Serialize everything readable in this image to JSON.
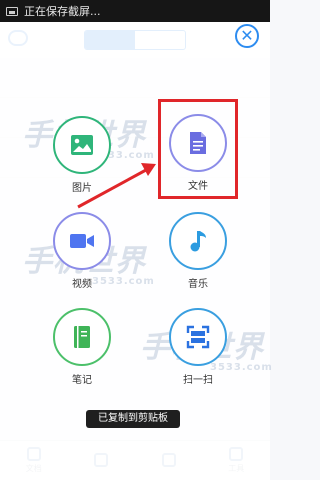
{
  "status_bar": {
    "text": "正在保存截屏..."
  },
  "background": {
    "tabs": [
      "",
      ""
    ],
    "bottom_nav": [
      "文档",
      "",
      "",
      "工具"
    ]
  },
  "menu": {
    "items": [
      {
        "id": "image",
        "label": "图片",
        "icon": "image-icon",
        "color": "#2fb57a"
      },
      {
        "id": "file",
        "label": "文件",
        "icon": "file-icon",
        "color": "#6a6de0"
      },
      {
        "id": "video",
        "label": "视频",
        "icon": "video-icon",
        "color": "#4f75f0"
      },
      {
        "id": "music",
        "label": "音乐",
        "icon": "music-icon",
        "color": "#2b9be0"
      },
      {
        "id": "notes",
        "label": "笔记",
        "icon": "notebook-icon",
        "color": "#3fb457"
      },
      {
        "id": "scan",
        "label": "扫一扫",
        "icon": "scan-icon",
        "color": "#2b72e0"
      }
    ]
  },
  "watermark": {
    "brand": "手机世界",
    "domain": "3533.com"
  },
  "toast": {
    "text": "已复制到剪贴板"
  },
  "annotation": {
    "color": "#e0262a"
  }
}
